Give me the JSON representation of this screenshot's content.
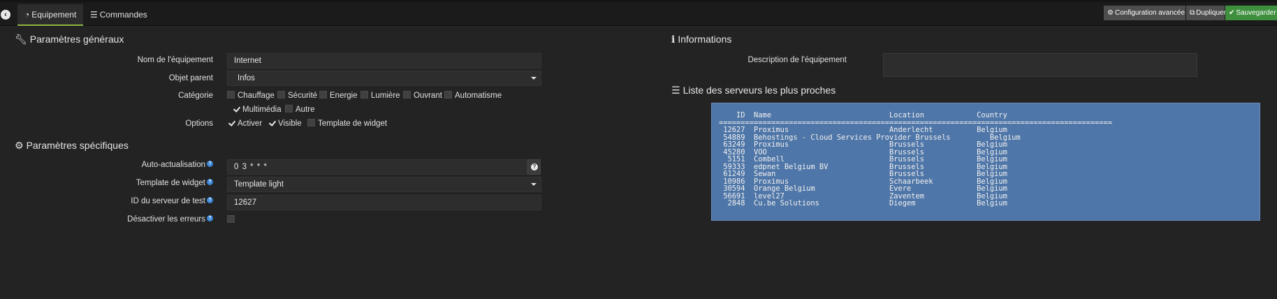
{
  "tabs": [
    {
      "label": "Equipement",
      "icon": "dashboard-icon",
      "active": true
    },
    {
      "label": "Commandes",
      "icon": "list-icon",
      "active": false
    }
  ],
  "actions": {
    "config_label": "Configuration avancée",
    "duplicate_label": "Dupliquer",
    "save_label": "Sauvegarder",
    "save_color": "#3e8f3e",
    "accent": "#8fb33e"
  },
  "general": {
    "title": "Paramètres généraux",
    "name_label": "Nom de l'équipement",
    "name_value": "Internet",
    "parent_label": "Objet parent",
    "parent_value": "Infos",
    "category_label": "Catégorie",
    "categories": [
      {
        "label": "Chauffage",
        "checked": false
      },
      {
        "label": "Sécurité",
        "checked": false
      },
      {
        "label": "Energie",
        "checked": false
      },
      {
        "label": "Lumière",
        "checked": false
      },
      {
        "label": "Ouvrant",
        "checked": false
      },
      {
        "label": "Automatisme",
        "checked": false
      },
      {
        "label": "Multimédia",
        "checked": true
      },
      {
        "label": "Autre",
        "checked": false
      }
    ],
    "options_label": "Options",
    "options": [
      {
        "label": "Activer",
        "checked": true
      },
      {
        "label": "Visible",
        "checked": true
      },
      {
        "label": "Template de widget",
        "checked": false
      }
    ]
  },
  "specific": {
    "title": "Paramètres spécifiques",
    "autorefresh_label": "Auto-actualisation",
    "autorefresh_value": "0 3 * * *",
    "template_label": "Template de widget",
    "template_value": "Template light",
    "server_id_label": "ID du serveur de test",
    "server_id_value": "12627",
    "disable_errors_label": "Désactiver les erreurs"
  },
  "info": {
    "title": "Informations",
    "description_label": "Description de l'équipement",
    "description_value": ""
  },
  "servers": {
    "title": "Liste des serveurs les plus proches",
    "headers": [
      "ID",
      "Name",
      "Location",
      "Country"
    ],
    "rows": [
      [
        "12627",
        "Proximus",
        "Anderlecht",
        "Belgium"
      ],
      [
        "54889",
        "Behostings - Cloud Services Provider Brussels",
        "",
        "Belgium"
      ],
      [
        "63249",
        "Proximus",
        "Brussels",
        "Belgium"
      ],
      [
        "45280",
        "VOO",
        "Brussels",
        "Belgium"
      ],
      [
        "5151",
        "Combell",
        "Brussels",
        "Belgium"
      ],
      [
        "59333",
        "edpnet Belgium BV",
        "Brussels",
        "Belgium"
      ],
      [
        "61249",
        "Sewan",
        "Brussels",
        "Belgium"
      ],
      [
        "10986",
        "Proximus",
        "Schaarbeek",
        "Belgium"
      ],
      [
        "30594",
        "Orange Belgium",
        "Evere",
        "Belgium"
      ],
      [
        "56691",
        "level27",
        "Zaventem",
        "Belgium"
      ],
      [
        "2848",
        "Cu.be Solutions",
        "Diegem",
        "Belgium"
      ]
    ]
  }
}
